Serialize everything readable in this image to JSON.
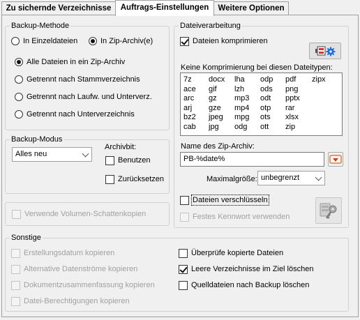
{
  "tabs": [
    {
      "label": "Zu sichernde Verzeichnisse"
    },
    {
      "label": "Auftrags-Einstellungen"
    },
    {
      "label": "Weitere Optionen"
    }
  ],
  "backup_methode": {
    "title": "Backup-Methode",
    "mode_einzel": "In Einzeldateien",
    "mode_zip": "In Zip-Archiv(e)",
    "opt_all": "Alle Dateien in ein Zip-Archiv",
    "opt_stamm": "Getrennt nach Stammverzeichnis",
    "opt_laufw": "Getrennt nach Laufw. und Unterverz.",
    "opt_unter": "Getrennt nach Unterverzeichnis"
  },
  "backup_modus": {
    "title": "Backup-Modus",
    "value": "Alles neu",
    "archivbit_label": "Archivbit:",
    "benutzen": "Benutzen",
    "zuruecksetzen": "Zurücksetzen"
  },
  "volumen_schatten": "Verwende Volumen-Schattenkopien",
  "dateiverarbeitung": {
    "title": "Dateiverarbeitung",
    "komprimieren": "Dateien komprimieren",
    "keine_label": "Keine Komprimierung bei diesen Dateitypen:",
    "types": [
      [
        "7z",
        "docx",
        "lha",
        "odp",
        "pdf",
        "zipx"
      ],
      [
        "ace",
        "gif",
        "lzh",
        "ods",
        "png",
        ""
      ],
      [
        "arc",
        "gz",
        "mp3",
        "odt",
        "pptx",
        ""
      ],
      [
        "arj",
        "gze",
        "mp4",
        "otp",
        "rar",
        ""
      ],
      [
        "bz2",
        "jpeg",
        "mpg",
        "ots",
        "xlsx",
        ""
      ],
      [
        "cab",
        "jpg",
        "odg",
        "ott",
        "zip",
        ""
      ]
    ],
    "zip_name_label": "Name des Zip-Archiv:",
    "zip_name_value": "PB-%date%",
    "max_label": "Maximalgröße:",
    "max_value": "unbegrenzt",
    "verschluesseln": "Dateien verschlüsseln",
    "kennwort": "Festes Kennwort verwenden"
  },
  "sonstige": {
    "title": "Sonstige",
    "erstellungsdatum": "Erstellungsdatum kopieren",
    "datenstroeme": "Alternative Datenströme kopieren",
    "zusammenfassung": "Dokumentzusammenfassung kopieren",
    "berechtigungen": "Datei-Berechtigungen kopieren",
    "ueberpruefe": "Überprüfe kopierte Dateien",
    "leere": "Leere Verzeichnisse im Ziel löschen",
    "quelldateien": "Quelldateien nach Backup löschen"
  },
  "colors": {
    "accent_blue": "#1e6fd9",
    "accent_red": "#d9342b",
    "accent_orange": "#e8762c"
  }
}
